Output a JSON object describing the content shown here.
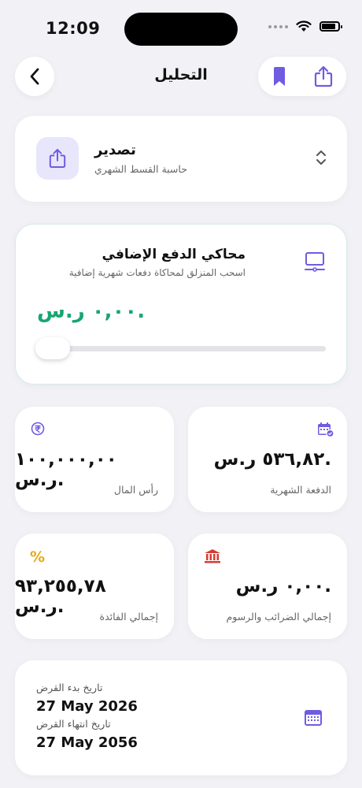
{
  "status_bar": {
    "time": "12:09"
  },
  "header": {
    "title": "التحليل"
  },
  "export": {
    "title": "تصدير",
    "subtitle": "حاسبة القسط الشهري"
  },
  "simulator": {
    "title": "محاكي الدفع الإضافي",
    "subtitle": "اسحب المنزلق لمحاكاة دفعات شهرية إضافية",
    "value": "٠,٠٠ ر.س.",
    "slider_level": 0
  },
  "stats": [
    {
      "value": "٥٣٦,٨٢ ر.س.",
      "label": "الدفعة الشهرية",
      "icon": "calendar-check-icon"
    },
    {
      "value": "١٠٠,٠٠٠,٠٠ ر.س.",
      "label": "رأس المال",
      "icon": "rupee-icon"
    },
    {
      "value": "٠,٠٠ ر.س.",
      "label": "إجمالي الضرائب والرسوم",
      "icon": "bank-icon"
    },
    {
      "value": "٩٣,٢٥٥,٧٨ ر.س.",
      "label": "إجمالي الفائدة",
      "icon": "percent-icon"
    }
  ],
  "dates": {
    "start_label": "تاريخ بدء القرض",
    "start_value": "27 May 2026",
    "end_label": "تاريخ انتهاء القرض",
    "end_value": "27 May 2056"
  },
  "colors": {
    "accent": "#6f5ce0",
    "value_green": "#17a673",
    "percent_orange": "#e8a817",
    "bank_red": "#d93b33",
    "background": "#f1f1f6"
  }
}
